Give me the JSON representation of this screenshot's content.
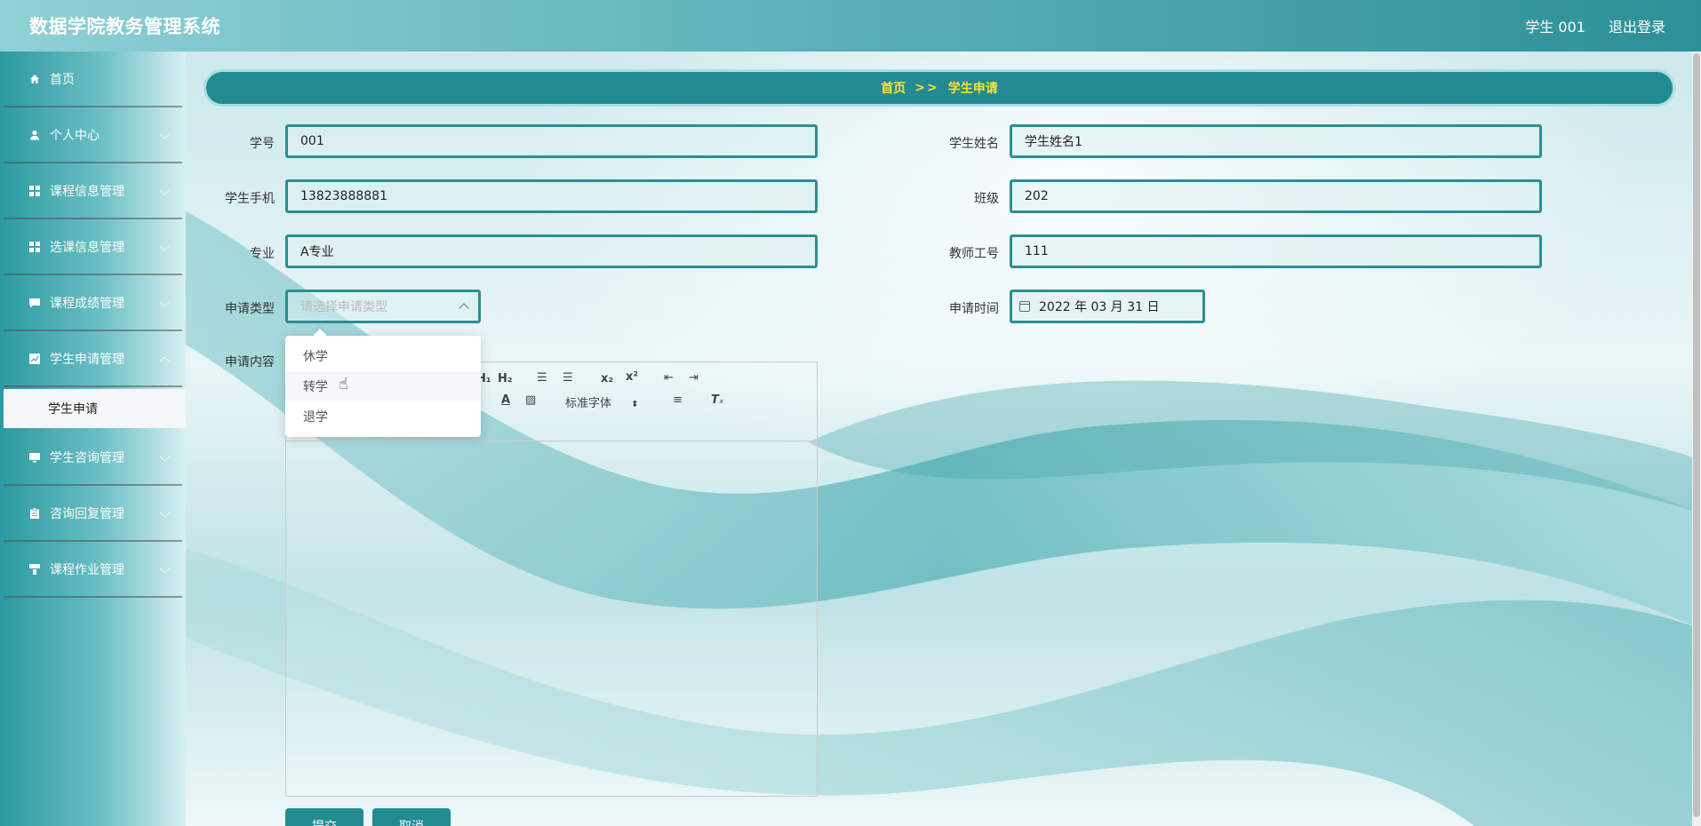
{
  "header": {
    "title": "数据学院教务管理系统",
    "user": "学生 001",
    "logout": "退出登录"
  },
  "sidebar": {
    "items": [
      {
        "label": "首页"
      },
      {
        "label": "个人中心"
      },
      {
        "label": "课程信息管理"
      },
      {
        "label": "选课信息管理"
      },
      {
        "label": "课程成绩管理"
      },
      {
        "label": "学生申请管理"
      },
      {
        "label": "学生咨询管理"
      },
      {
        "label": "咨询回复管理"
      },
      {
        "label": "课程作业管理"
      }
    ],
    "active_sub": "学生申请"
  },
  "breadcrumb": {
    "home": "首页",
    "sep": ">>",
    "current": "学生申请"
  },
  "form": {
    "student_no_label": "学号",
    "student_no": "001",
    "student_name_label": "学生姓名",
    "student_name": "学生姓名1",
    "phone_label": "学生手机",
    "phone": "13823888881",
    "class_label": "班级",
    "class": "202",
    "major_label": "专业",
    "major": "A专业",
    "teacher_no_label": "教师工号",
    "teacher_no": "111",
    "apply_type_label": "申请类型",
    "apply_type_placeholder": "请选择申请类型",
    "apply_time_label": "申请时间",
    "apply_time": "2022 年 03 月 31 日",
    "content_label": "申请内容"
  },
  "dropdown": {
    "options": [
      "休学",
      "转学",
      "退学"
    ],
    "hovered": "转学"
  },
  "editor": {
    "font_select": "标准字体"
  },
  "buttons": {
    "submit": "提交",
    "cancel": "取消"
  }
}
